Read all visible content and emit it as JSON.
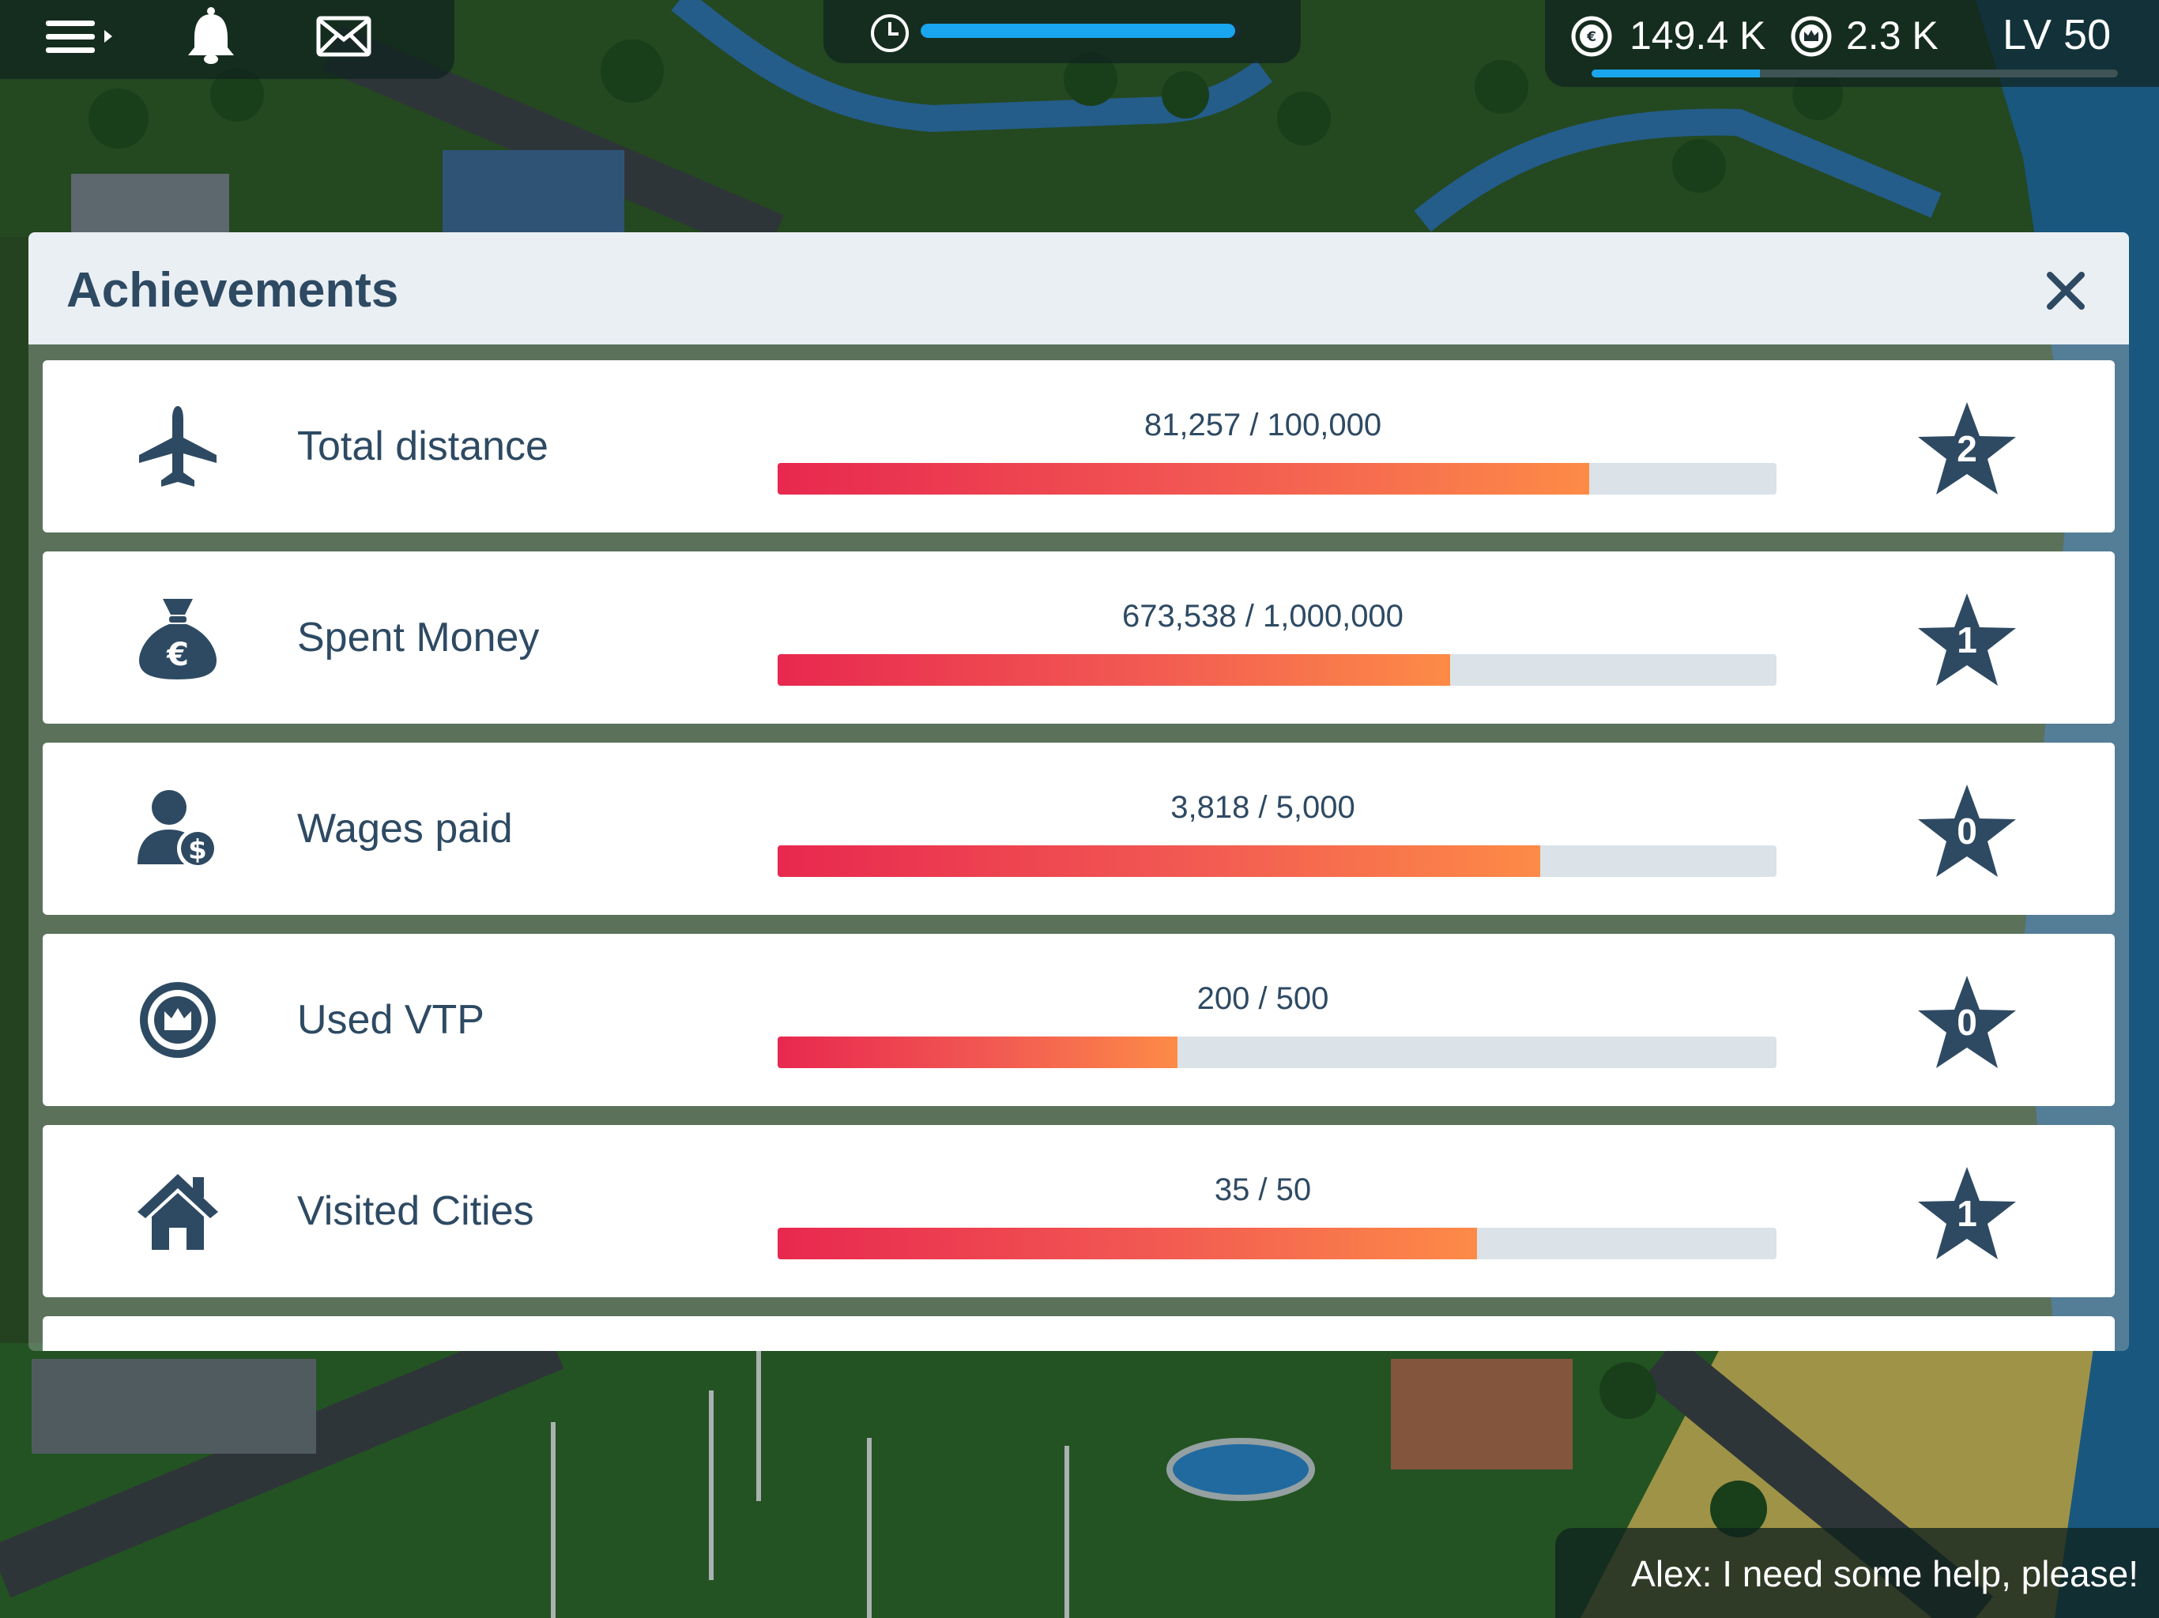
{
  "hud": {
    "euro_currency": "149.4 K",
    "vtp_currency": "2.3 K",
    "level": "LV 50",
    "timer_progress": 0.98,
    "xp_progress": 0.32,
    "icons": [
      "menu-icon",
      "bell-icon",
      "mail-icon",
      "clock-icon",
      "euro-coin-icon",
      "crown-coin-icon"
    ]
  },
  "dialog": {
    "title": "Achievements",
    "close_icon": "close-icon"
  },
  "achievements": [
    {
      "label": "Total distance",
      "progress_text": "81,257 / 100,000",
      "current": 81257,
      "target": 100000,
      "stars": "2",
      "icon": "airplane-icon"
    },
    {
      "label": "Spent Money",
      "progress_text": "673,538 / 1,000,000",
      "current": 673538,
      "target": 1000000,
      "stars": "1",
      "icon": "money-bag-icon"
    },
    {
      "label": "Wages paid",
      "progress_text": "3,818 / 5,000",
      "current": 3818,
      "target": 5000,
      "stars": "0",
      "icon": "wage-worker-icon"
    },
    {
      "label": "Used VTP",
      "progress_text": "200 / 500",
      "current": 200,
      "target": 500,
      "stars": "0",
      "icon": "crown-coin-icon"
    },
    {
      "label": "Visited Cities",
      "progress_text": "35 / 50",
      "current": 35,
      "target": 50,
      "stars": "1",
      "icon": "house-icon"
    }
  ],
  "chat": {
    "message": "Alex: I need some help, please!"
  },
  "colors": {
    "accent_blue": "#19a6ee",
    "text_dark": "#2e4a63",
    "bar_start": "#e8284f",
    "bar_end": "#fd8b47",
    "bar_track": "#dbe3e9"
  }
}
